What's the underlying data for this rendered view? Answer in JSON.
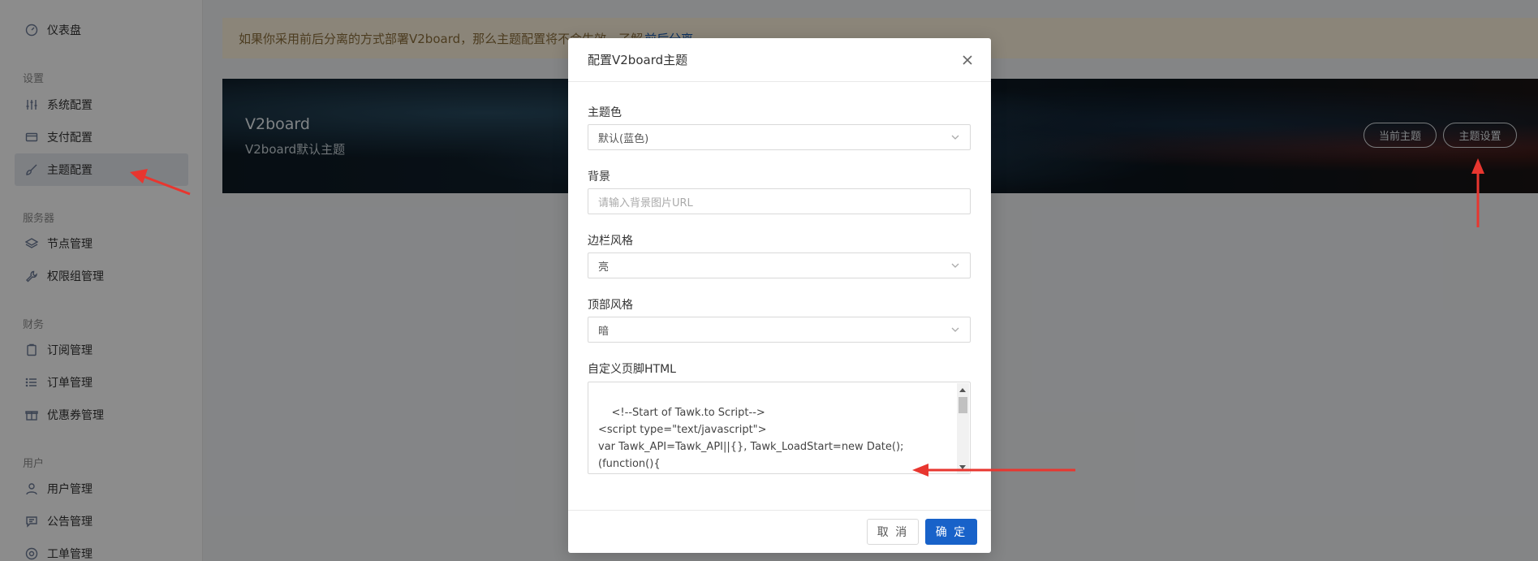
{
  "sidebar": {
    "groups": {
      "settings": "设置",
      "servers": "服务器",
      "finance": "财务",
      "users": "用户"
    },
    "items": [
      {
        "label": "仪表盘",
        "icon": "dashboard-icon"
      },
      {
        "label": "系统配置",
        "icon": "sliders-icon"
      },
      {
        "label": "支付配置",
        "icon": "credit-card-icon"
      },
      {
        "label": "主题配置",
        "icon": "brush-icon"
      },
      {
        "label": "节点管理",
        "icon": "layers-icon"
      },
      {
        "label": "权限组管理",
        "icon": "wrench-icon"
      },
      {
        "label": "订阅管理",
        "icon": "clipboard-icon"
      },
      {
        "label": "订单管理",
        "icon": "list-icon"
      },
      {
        "label": "优惠券管理",
        "icon": "gift-icon"
      },
      {
        "label": "用户管理",
        "icon": "user-icon"
      },
      {
        "label": "公告管理",
        "icon": "message-icon"
      },
      {
        "label": "工单管理",
        "icon": "support-icon"
      }
    ]
  },
  "notice": {
    "text": "如果你采用前后分离的方式部署V2board，那么主题配置将不会生效。了解",
    "link": "前后分离"
  },
  "theme_card": {
    "title": "V2board",
    "description": "V2board默认主题",
    "current_button": "当前主题",
    "settings_button": "主题设置"
  },
  "modal": {
    "title": "配置V2board主题",
    "fields": {
      "theme_color_label": "主题色",
      "theme_color_value": "默认(蓝色)",
      "background_label": "背景",
      "background_placeholder": "请输入背景图片URL",
      "sidebar_style_label": "边栏风格",
      "sidebar_style_value": "亮",
      "header_style_label": "顶部风格",
      "header_style_value": "暗",
      "footer_html_label": "自定义页脚HTML",
      "footer_html_value": "<!--Start of Tawk.to Script-->\n<script type=\"text/javascript\">\nvar Tawk_API=Tawk_API||{}, Tawk_LoadStart=new Date();\n(function(){\nvar"
    },
    "cancel_label": "取 消",
    "ok_label": "确 定"
  },
  "colors": {
    "primary": "#1862c9",
    "active_nav_bg": "#e6e9ef",
    "notice_bg": "#fdf3dc",
    "annotation_arrow": "#e8362f"
  }
}
